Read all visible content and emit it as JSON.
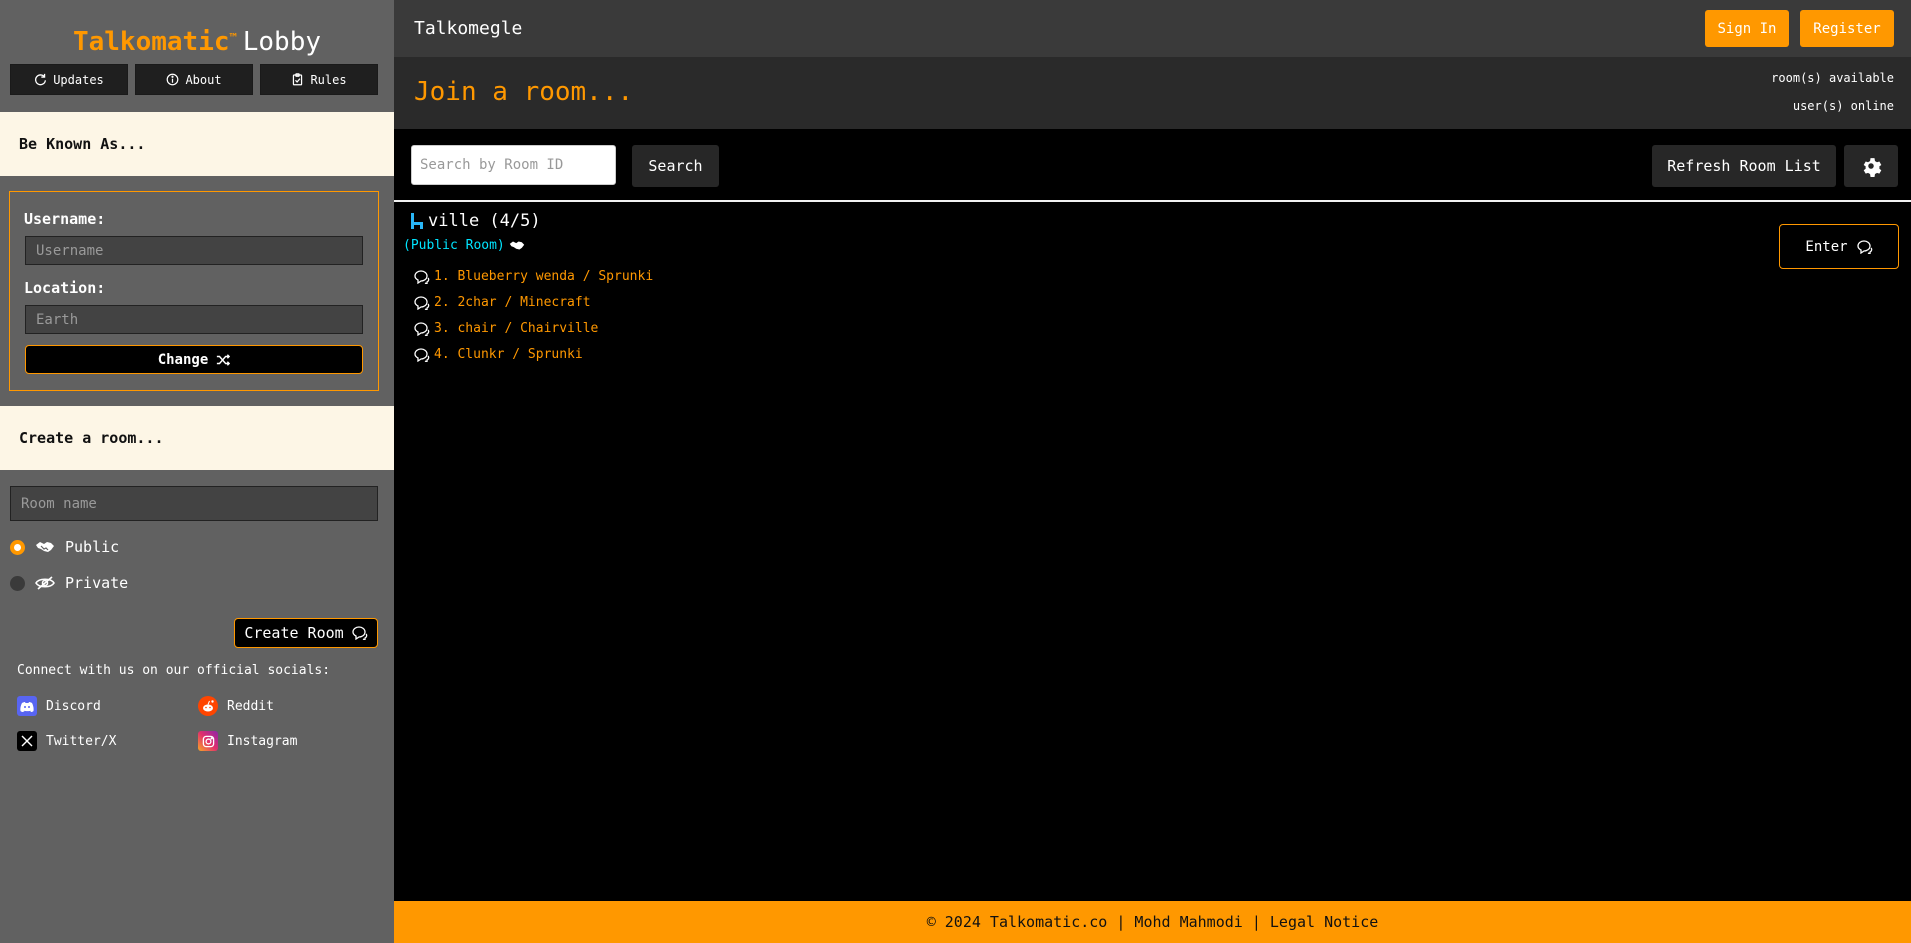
{
  "sidebar": {
    "logo": {
      "brand": "Talkomatic",
      "tm": "™",
      "suffix": "Lobby"
    },
    "nav": [
      {
        "label": "Updates",
        "icon": "refresh-icon"
      },
      {
        "label": "About",
        "icon": "info-icon"
      },
      {
        "label": "Rules",
        "icon": "clipboard-icon"
      }
    ],
    "known_as": {
      "heading": "Be Known As...",
      "username_label": "Username:",
      "username_placeholder": "Username",
      "location_label": "Location:",
      "location_placeholder": "Earth",
      "change_label": "Change"
    },
    "create": {
      "heading": "Create a room...",
      "room_name_placeholder": "Room name",
      "public_label": "Public",
      "private_label": "Private",
      "selected": "Public",
      "create_label": "Create Room"
    },
    "socials": {
      "title": "Connect with us on our official socials:",
      "items": [
        {
          "label": "Discord",
          "icon": "discord-icon",
          "color": "#5865f2"
        },
        {
          "label": "Reddit",
          "icon": "reddit-icon",
          "color": "#ff4500"
        },
        {
          "label": "Twitter/X",
          "icon": "x-icon",
          "color": "#000000"
        },
        {
          "label": "Instagram",
          "icon": "instagram-icon",
          "color": "#e1306c"
        }
      ]
    }
  },
  "header": {
    "site_title": "Talkomegle",
    "sign_in": "Sign In",
    "register": "Register"
  },
  "lobby": {
    "join_title": "Join a room...",
    "rooms_available": "room(s) available",
    "users_online": "user(s) online",
    "search_placeholder": "Search by Room ID",
    "search_label": "Search",
    "refresh_label": "Refresh Room List",
    "settings_icon": "gear-icon"
  },
  "room": {
    "name": "ville (4/5)",
    "type": "(Public Room)",
    "enter_label": "Enter",
    "users": [
      "1. Blueberry wenda / Sprunki",
      "2. 2char / Minecraft",
      "3. chair / Chairville",
      "4. Clunkr / Sprunki"
    ]
  },
  "footer": {
    "text": "© 2024 Talkomatic.co | Mohd Mahmodi | Legal Notice"
  },
  "colors": {
    "accent": "#ff9800",
    "sidebar_bg": "#616161",
    "cream": "#fdf6e6",
    "room_type": "#00e5ff"
  }
}
